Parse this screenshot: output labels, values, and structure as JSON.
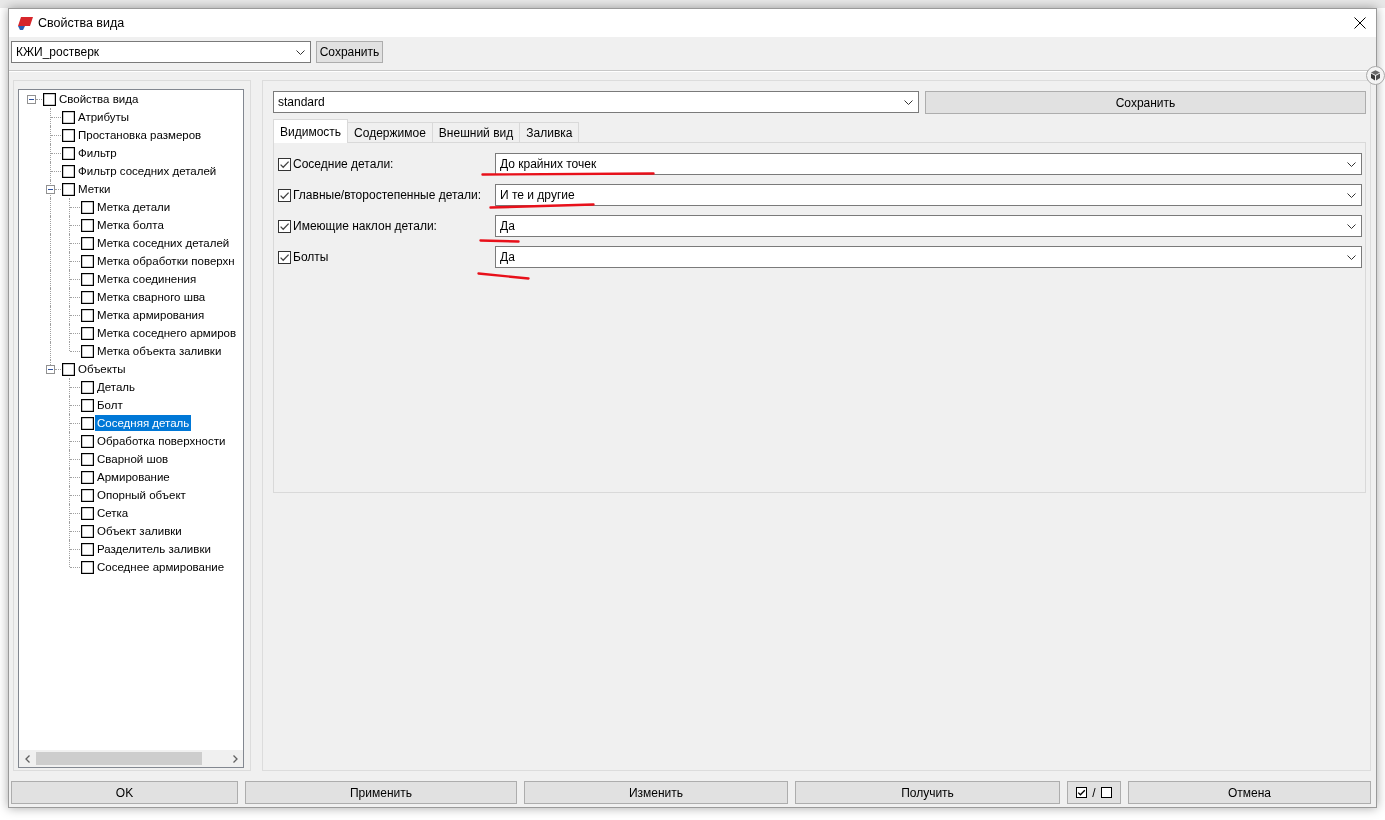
{
  "window": {
    "title": "Свойства вида"
  },
  "view": {
    "value": "КЖИ_ростверк",
    "save_button": "Сохранить"
  },
  "tree": {
    "items": [
      {
        "label": "Свойства вида",
        "checked": false,
        "selected": false,
        "expanded": true,
        "children": [
          {
            "label": "Атрибуты",
            "checked": false,
            "selected": false
          },
          {
            "label": "Простановка размеров",
            "checked": false,
            "selected": false
          },
          {
            "label": "Фильтр",
            "checked": false,
            "selected": false
          },
          {
            "label": "Фильтр соседних деталей",
            "checked": false,
            "selected": false
          },
          {
            "label": "Метки",
            "checked": false,
            "selected": false,
            "expanded": true,
            "children": [
              {
                "label": "Метка детали",
                "checked": false,
                "selected": false
              },
              {
                "label": "Метка болта",
                "checked": false,
                "selected": false
              },
              {
                "label": "Метка соседних деталей",
                "checked": false,
                "selected": false
              },
              {
                "label": "Метка обработки поверхн",
                "checked": false,
                "selected": false
              },
              {
                "label": "Метка соединения",
                "checked": false,
                "selected": false
              },
              {
                "label": "Метка сварного шва",
                "checked": false,
                "selected": false
              },
              {
                "label": "Метка армирования",
                "checked": false,
                "selected": false
              },
              {
                "label": "Метка соседнего армиров",
                "checked": false,
                "selected": false
              },
              {
                "label": "Метка объекта заливки",
                "checked": false,
                "selected": false
              }
            ]
          },
          {
            "label": "Объекты",
            "checked": false,
            "selected": false,
            "expanded": true,
            "children": [
              {
                "label": "Деталь",
                "checked": false,
                "selected": false
              },
              {
                "label": "Болт",
                "checked": false,
                "selected": false
              },
              {
                "label": "Соседняя деталь",
                "checked": false,
                "selected": true
              },
              {
                "label": "Обработка поверхности",
                "checked": false,
                "selected": false
              },
              {
                "label": "Сварной шов",
                "checked": false,
                "selected": false
              },
              {
                "label": "Армирование",
                "checked": false,
                "selected": false
              },
              {
                "label": "Опорный объект",
                "checked": false,
                "selected": false
              },
              {
                "label": "Сетка",
                "checked": false,
                "selected": false
              },
              {
                "label": "Объект заливки",
                "checked": false,
                "selected": false
              },
              {
                "label": "Разделитель заливки",
                "checked": false,
                "selected": false
              },
              {
                "label": "Соседнее армирование",
                "checked": false,
                "selected": false
              }
            ]
          }
        ]
      }
    ]
  },
  "settings": {
    "value": "standard",
    "save_button": "Сохранить"
  },
  "tabs": [
    {
      "label": "Видимость",
      "selected": true
    },
    {
      "label": "Содержимое",
      "selected": false
    },
    {
      "label": "Внешний вид",
      "selected": false
    },
    {
      "label": "Заливка",
      "selected": false
    }
  ],
  "visibility": [
    {
      "label": "Соседние детали:",
      "checked": true,
      "value": "До крайних точек",
      "underlined": true
    },
    {
      "label": "Главные/второстепенные детали:",
      "checked": true,
      "value": "И те и другие",
      "underlined": true
    },
    {
      "label": "Имеющие наклон детали:",
      "checked": true,
      "value": "Да",
      "underlined": true
    },
    {
      "label": "Болты",
      "checked": true,
      "value": "Да",
      "underlined": true
    }
  ],
  "buttons": [
    {
      "kind": "text",
      "label": "OK"
    },
    {
      "kind": "text",
      "label": "Применить"
    },
    {
      "kind": "text",
      "label": "Изменить"
    },
    {
      "kind": "text",
      "label": "Получить"
    },
    {
      "kind": "toggle",
      "label": "/"
    },
    {
      "kind": "text",
      "label": "Отмена"
    }
  ]
}
